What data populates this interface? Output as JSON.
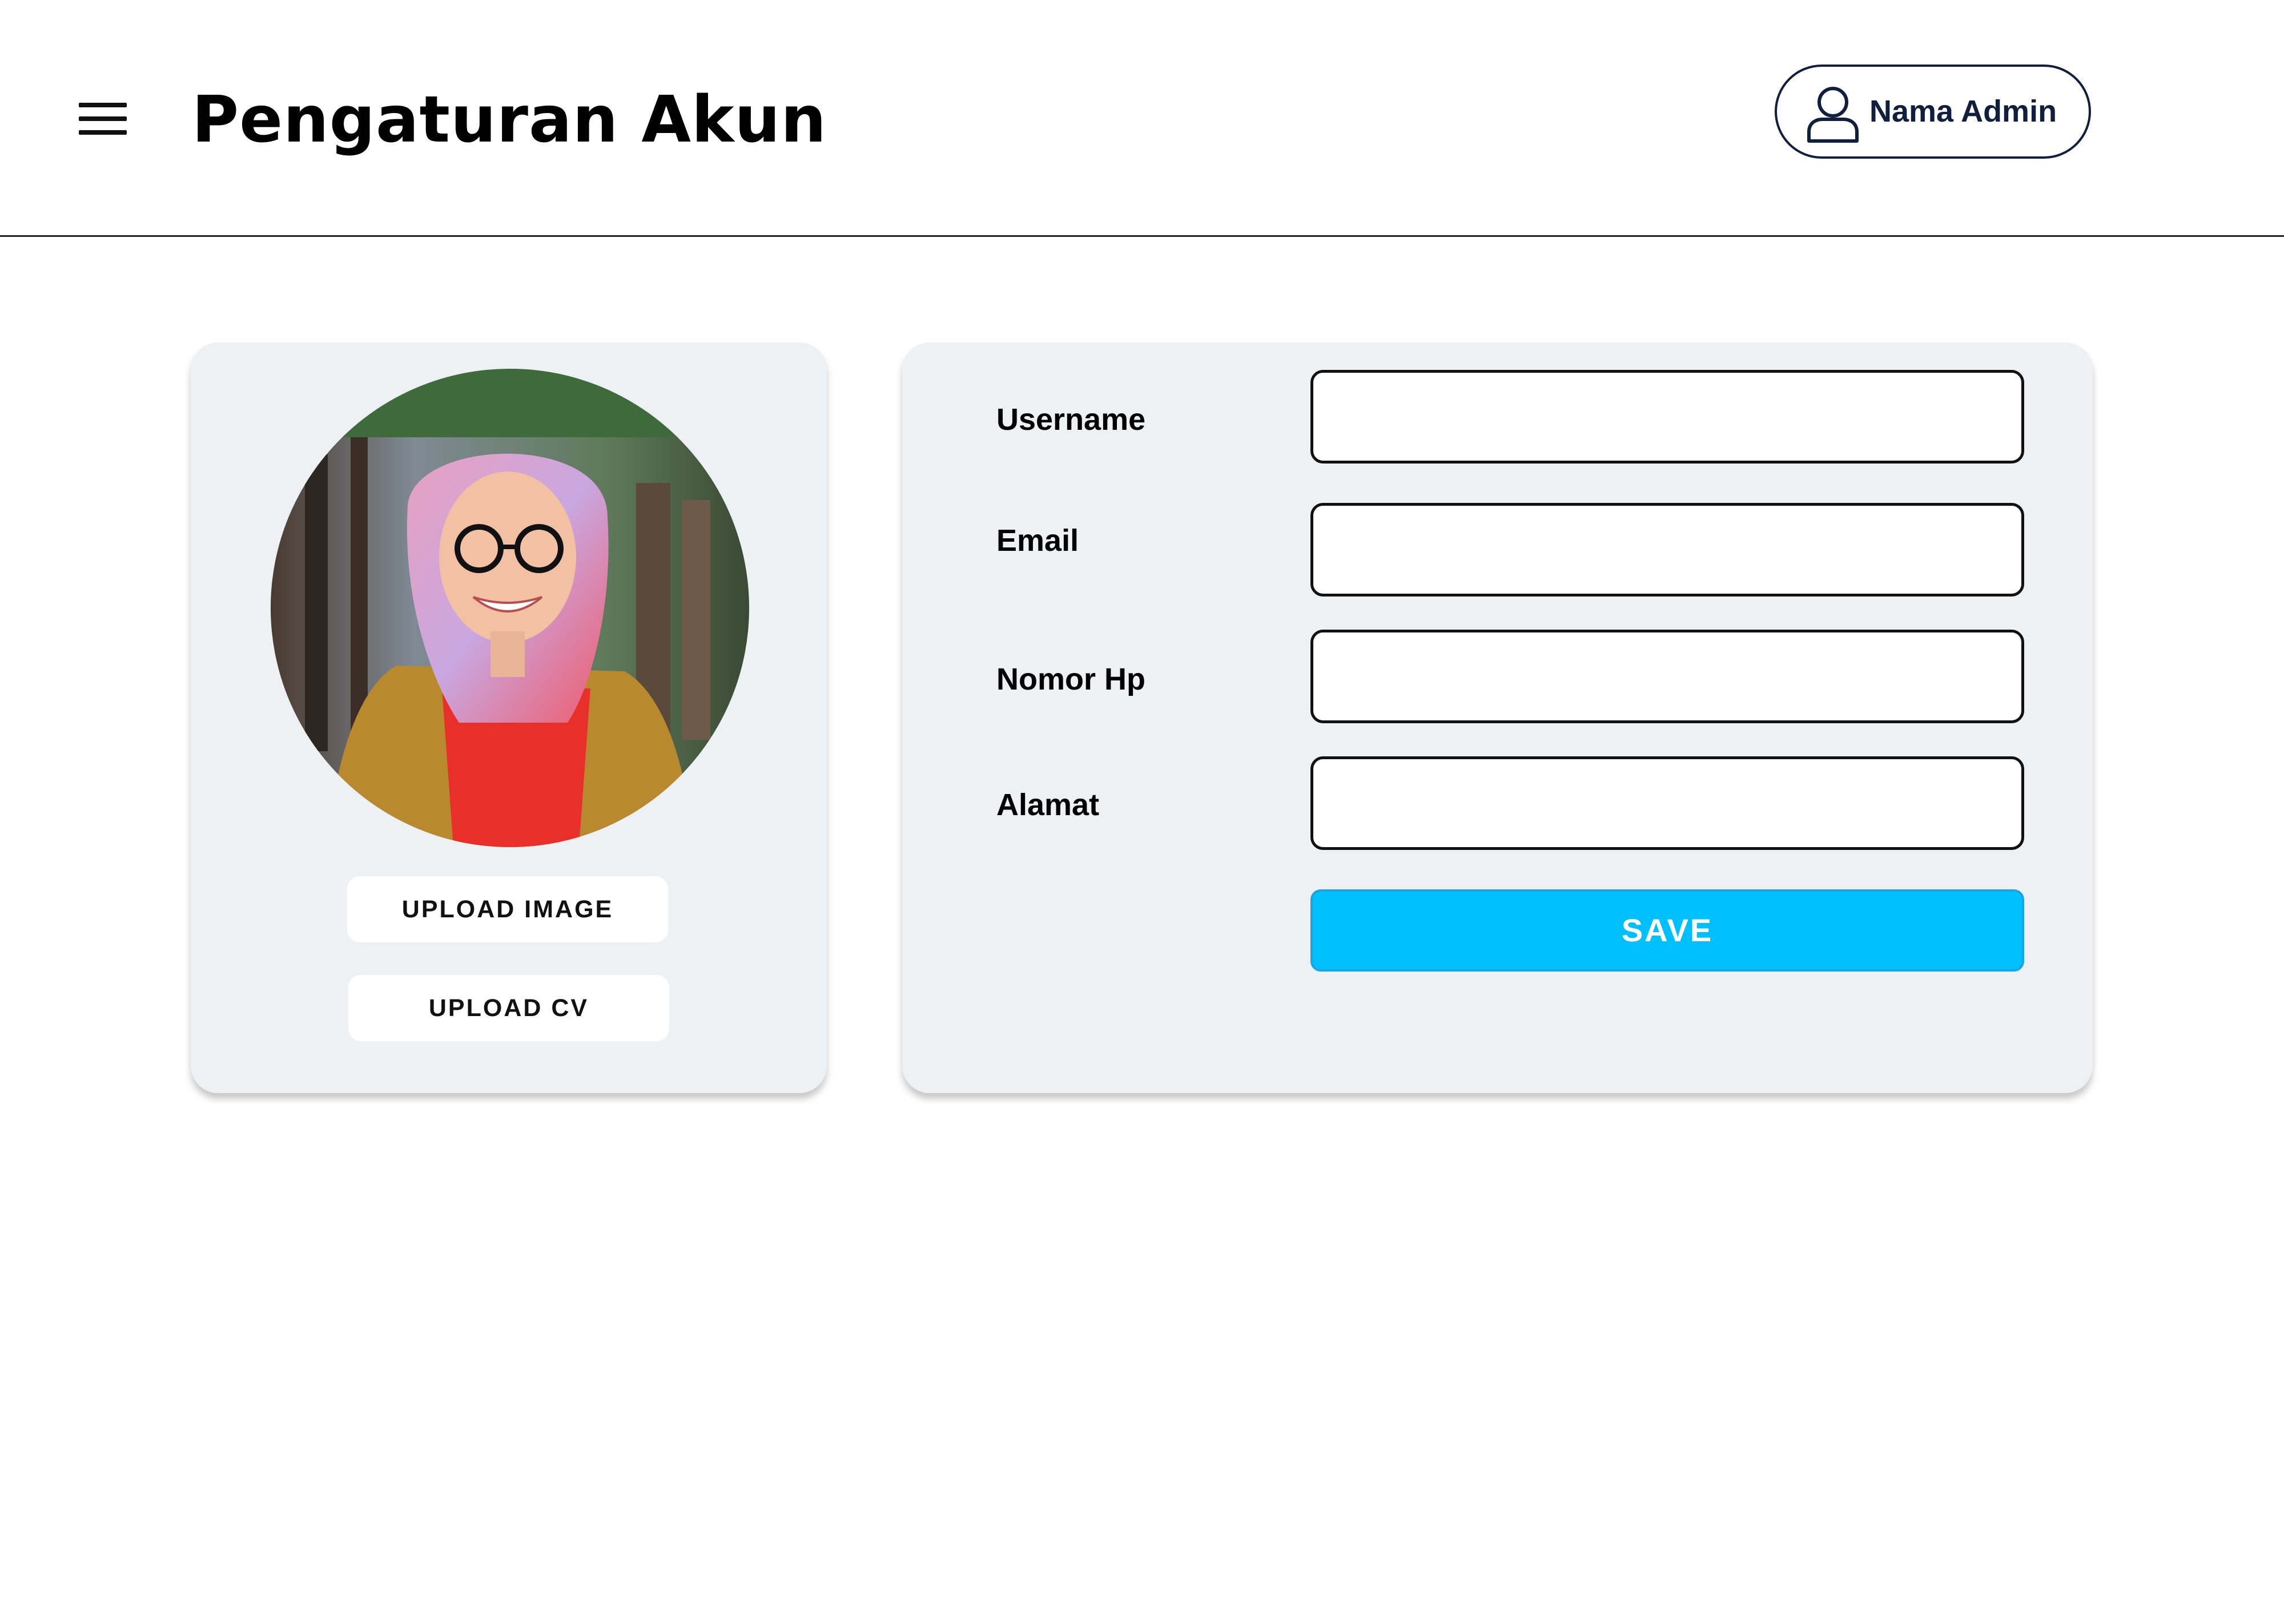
{
  "header": {
    "title": "Pengaturan Akun",
    "menu_icon": "hamburger-menu-icon",
    "user": {
      "name": "Nama Admin",
      "icon": "user-icon"
    }
  },
  "profile": {
    "photo_alt": "profile photo",
    "upload_image_label": "UPLOAD IMAGE",
    "upload_cv_label": "UPLOAD CV"
  },
  "form": {
    "fields": [
      {
        "label": "Username",
        "value": "",
        "placeholder": ""
      },
      {
        "label": "Email",
        "value": "",
        "placeholder": ""
      },
      {
        "label": "Nomor Hp",
        "value": "",
        "placeholder": ""
      },
      {
        "label": "Alamat",
        "value": "",
        "placeholder": ""
      }
    ],
    "save_label": "SAVE"
  },
  "colors": {
    "accent": "#00bfff",
    "card_background": "#edf1f4",
    "user_chip_border": "#0f1f3d",
    "text": "#000000"
  }
}
